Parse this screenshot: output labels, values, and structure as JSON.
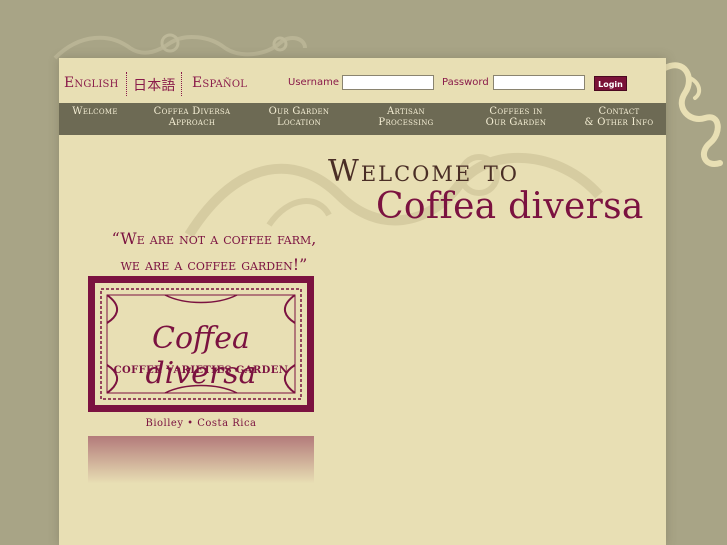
{
  "languages": [
    {
      "label": "English"
    },
    {
      "label": "日本語"
    },
    {
      "label": "Español"
    }
  ],
  "login": {
    "username_label": "Username",
    "password_label": "Password",
    "username_value": "",
    "password_value": "",
    "button_label": "Login"
  },
  "nav": [
    {
      "line1": "Welcome",
      "line2": ""
    },
    {
      "line1": "Coffea Diversa",
      "line2": "Approach"
    },
    {
      "line1": "Our Garden",
      "line2": "Location"
    },
    {
      "line1": "Artisan",
      "line2": "Processing"
    },
    {
      "line1": "Coffees in",
      "line2": "Our Garden"
    },
    {
      "line1": "Contact",
      "line2": "& Other Info"
    }
  ],
  "heading": {
    "line1": "Welcome to",
    "line2": "Coffea diversa"
  },
  "quote": {
    "line1": "“We are not a coffee farm,",
    "line2": "we are a coffee garden!”"
  },
  "logo": {
    "title": "Coffea diversa",
    "subtitle": "COFFEE VARIETIES GARDEN"
  },
  "location": "Biolley • Costa Rica",
  "colors": {
    "page_bg": "#a8a486",
    "panel_bg": "#e8dfb4",
    "nav_bg": "#6d6a54",
    "accent": "#7b1240",
    "heading_dark": "#4a2e26"
  }
}
